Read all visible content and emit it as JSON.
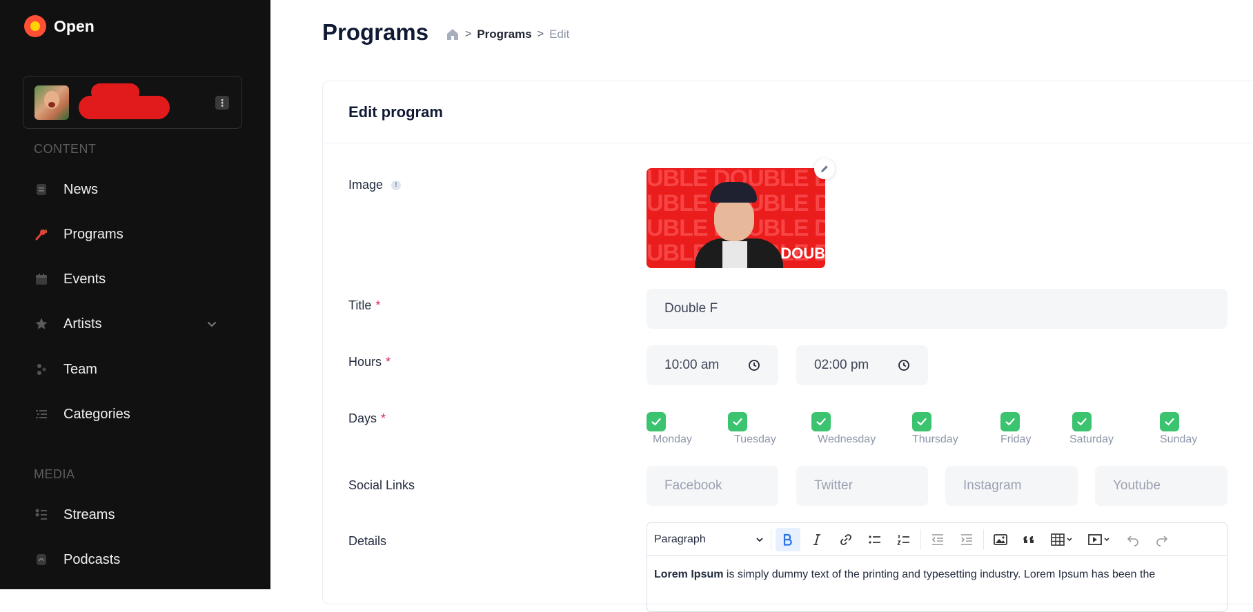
{
  "brand": {
    "name": "Open"
  },
  "sidebar": {
    "content_label": "CONTENT",
    "media_label": "MEDIA",
    "items": [
      {
        "label": "News",
        "icon": "news-icon"
      },
      {
        "label": "Programs",
        "icon": "microphone-icon"
      },
      {
        "label": "Events",
        "icon": "calendar-icon"
      },
      {
        "label": "Artists",
        "icon": "star-icon"
      },
      {
        "label": "Team",
        "icon": "team-icon"
      },
      {
        "label": "Categories",
        "icon": "list-icon"
      }
    ],
    "media_items": [
      {
        "label": "Streams",
        "icon": "streams-icon"
      },
      {
        "label": "Podcasts",
        "icon": "podcast-icon"
      }
    ],
    "user_menu_glyph": "⋮"
  },
  "header": {
    "title": "Programs",
    "breadcrumb": {
      "sep": ">",
      "link": "Programs",
      "current": "Edit"
    }
  },
  "form": {
    "title": "Edit program",
    "image_label": "Image",
    "image_info_glyph": "!",
    "image_badge": "DOUB",
    "image_pattern_rows": [
      "UBLE DOUBLE DOUBLE",
      "UBLE DOUBLE DOUBLE",
      "UBLE DOUBLE DOUBLE",
      "UBLE DOUBLE DOUBLE"
    ],
    "title_label": "Title",
    "title_value": "Double F",
    "hours_label": "Hours",
    "hours_start": "10:00 am",
    "hours_end": "02:00 pm",
    "days_label": "Days",
    "days": [
      "Monday",
      "Tuesday",
      "Wednesday",
      "Thursday",
      "Friday",
      "Saturday",
      "Sunday"
    ],
    "social_label": "Social Links",
    "social_placeholders": [
      "Facebook",
      "Twitter",
      "Instagram",
      "Youtube"
    ],
    "details_label": "Details",
    "editor": {
      "paragraph_select": "Paragraph",
      "body_bold": "Lorem Ipsum",
      "body_text": " is simply dummy text of the printing and typesetting industry. Lorem Ipsum has been the"
    },
    "required_mark": "*"
  },
  "colors": {
    "sidebar_bg": "#111111",
    "accent_green": "#3cc36f",
    "required": "#e0245e",
    "brand_red": "#ff4f35"
  }
}
